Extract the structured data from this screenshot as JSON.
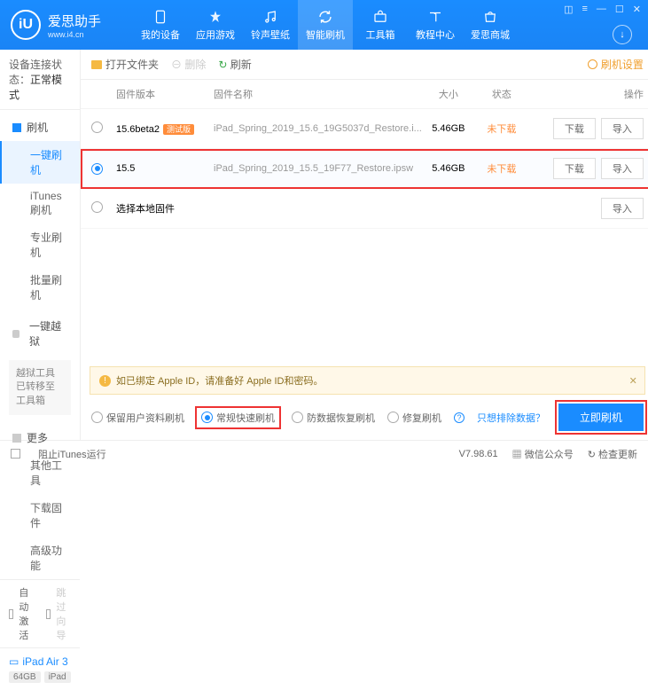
{
  "app": {
    "name_cn": "爱思助手",
    "name_en": "www.i4.cn",
    "logo_letter": "iU"
  },
  "nav": [
    {
      "label": "我的设备"
    },
    {
      "label": "应用游戏"
    },
    {
      "label": "铃声壁纸"
    },
    {
      "label": "智能刷机"
    },
    {
      "label": "工具箱"
    },
    {
      "label": "教程中心"
    },
    {
      "label": "爱思商城"
    }
  ],
  "sidebar": {
    "conn_label": "设备连接状态：",
    "conn_value": "正常模式",
    "g1": "刷机",
    "g1_items": [
      "一键刷机",
      "iTunes刷机",
      "专业刷机",
      "批量刷机"
    ],
    "g2": "一键越狱",
    "g2_note": "越狱工具已转移至工具箱",
    "g3": "更多",
    "g3_items": [
      "其他工具",
      "下载固件",
      "高级功能"
    ],
    "auto_activate": "自动激活",
    "skip_guide": "跳过向导",
    "device_name": "iPad Air 3",
    "device_storage": "64GB",
    "device_model": "iPad"
  },
  "toolbar": {
    "open_folder": "打开文件夹",
    "delete": "删除",
    "refresh": "刷新",
    "settings": "刷机设置"
  },
  "thead": {
    "version": "固件版本",
    "name": "固件名称",
    "size": "大小",
    "status": "状态",
    "ops": "操作"
  },
  "rows": [
    {
      "version": "15.6beta2",
      "beta": "测试版",
      "name": "iPad_Spring_2019_15.6_19G5037d_Restore.i...",
      "size": "5.46GB",
      "status": "未下载"
    },
    {
      "version": "15.5",
      "beta": "",
      "name": "iPad_Spring_2019_15.5_19F77_Restore.ipsw",
      "size": "5.46GB",
      "status": "未下载"
    }
  ],
  "ops": {
    "download": "下载",
    "import": "导入"
  },
  "local_row": "选择本地固件",
  "notice": "如已绑定 Apple ID，请准备好 Apple ID和密码。",
  "modes": {
    "keep": "保留用户资料刷机",
    "normal": "常规快速刷机",
    "anti": "防数据恢复刷机",
    "repair": "修复刷机",
    "exclude": "只想排除数据？"
  },
  "primary": "立即刷机",
  "status": {
    "block_itunes": "阻止iTunes运行",
    "version": "V7.98.61",
    "wechat": "微信公众号",
    "check": "检查更新"
  }
}
